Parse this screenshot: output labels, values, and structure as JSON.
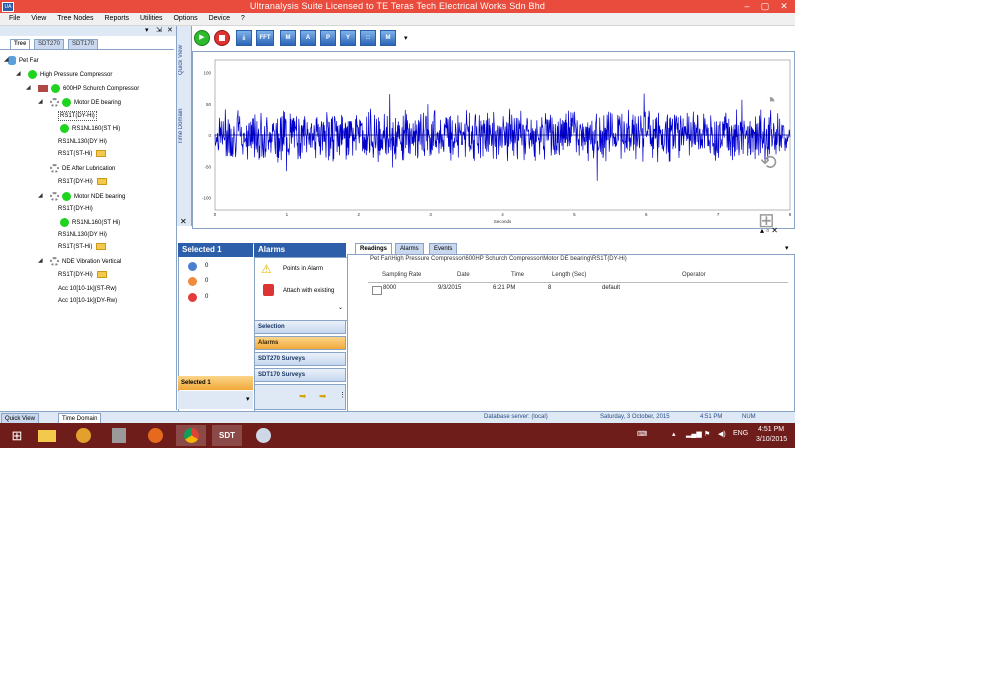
{
  "window": {
    "title": "Ultranalysis Suite Licensed to TE Teras Tech Electrical Works Sdn Bhd",
    "controls": [
      "–",
      "▢",
      "✕"
    ]
  },
  "menu": [
    "File",
    "View",
    "Tree Nodes",
    "Reports",
    "Utilities",
    "Options",
    "Device",
    "?"
  ],
  "left_panel": {
    "tabs": [
      "Tree",
      "SDT270",
      "SDT170"
    ],
    "tree": [
      {
        "label": "Pet Far",
        "kind": "database"
      },
      {
        "label": "High Pressure Compressor",
        "kind": "green"
      },
      {
        "label": "600HP Schurch Compressor",
        "kind": "machine"
      },
      {
        "label": "Motor DE bearing",
        "kind": "gear-green"
      },
      {
        "label": "RS1T(DY-Hi)",
        "kind": "text"
      },
      {
        "label": "RS1NL160(ST Hi)",
        "kind": "green"
      },
      {
        "label": "RS1NL130(DY Hi)",
        "kind": "text"
      },
      {
        "label": "RS1T(ST-Hi)",
        "kind": "folder"
      },
      {
        "label": "DE After Lubrication",
        "kind": "gear"
      },
      {
        "label": "RS1T(DY-Hi)",
        "kind": "folder"
      },
      {
        "label": "Motor NDE bearing",
        "kind": "gear-green"
      },
      {
        "label": "RS1T(DY-Hi)",
        "kind": "text"
      },
      {
        "label": "RS1NL160(ST Hi)",
        "kind": "green"
      },
      {
        "label": "RS1NL130(DY Hi)",
        "kind": "text"
      },
      {
        "label": "RS1T(ST-Hi)",
        "kind": "folder"
      },
      {
        "label": "NDE Vibration Vertical",
        "kind": "gear"
      },
      {
        "label": "RS1T(DY-Hi)",
        "kind": "folder"
      },
      {
        "label": "Acc 10[10-1k](ST-Rw)",
        "kind": "text"
      },
      {
        "label": "Acc 10[10-1k](DY-Rw)",
        "kind": "text"
      }
    ]
  },
  "side_tabs": [
    "Quick View",
    "Time Domain"
  ],
  "toolbar": [
    "play",
    "stop",
    "export",
    "FFT",
    "M",
    "A",
    "P",
    "Y",
    "□",
    "M+"
  ],
  "toolbar_fft": "FFT",
  "chart_data": {
    "type": "line",
    "title": "",
    "xlabel": "Seconds",
    "ylabel": "",
    "series_color": "#0000cc",
    "y_ticks": [
      "100",
      "50",
      "0",
      "-50",
      "-100"
    ],
    "x_ticks": [
      "0",
      "1",
      "2",
      "3",
      "4",
      "5",
      "6",
      "7",
      "8"
    ],
    "ylim": [
      -120,
      120
    ],
    "xlim": [
      0,
      8
    ]
  },
  "selected_panel": {
    "header": "Selected 1",
    "counts": [
      {
        "color": "#4a7fd0",
        "value": "0"
      },
      {
        "color": "#f08a3c",
        "value": "0"
      },
      {
        "color": "#e33a3a",
        "value": "0"
      }
    ],
    "selected_label": "Selected 1"
  },
  "alarms_panel": {
    "header": "Alarms",
    "items": [
      "Points in Alarm",
      "Attach with existing"
    ]
  },
  "nav": [
    "Selection",
    "Alarms",
    "SDT270 Surveys",
    "SDT170 Surveys"
  ],
  "readings": {
    "tabs": [
      "Readings",
      "Alarms",
      "Events"
    ],
    "path": "Pet Far\\High Pressure Compressor\\600HP Schurch Compressor\\Motor DE bearing\\RS1T(DY-Hi)",
    "columns": [
      "Sampling Rate",
      "Date",
      "Time",
      "Length (Sec)",
      "Operator"
    ],
    "rows": [
      [
        "8000",
        "9/3/2015",
        "6:21 PM",
        "8",
        "default"
      ]
    ]
  },
  "status": {
    "tabs": [
      "Quick View",
      "Time Domain"
    ],
    "db": "Database server: (local)",
    "date": "Saturday, 3 October, 2015",
    "time": "4:51 PM",
    "mode": "NUM"
  },
  "taskbar": {
    "lang": "ENG",
    "clock_time": "4:51 PM",
    "clock_date": "3/10/2015",
    "sdt": "SDT"
  }
}
